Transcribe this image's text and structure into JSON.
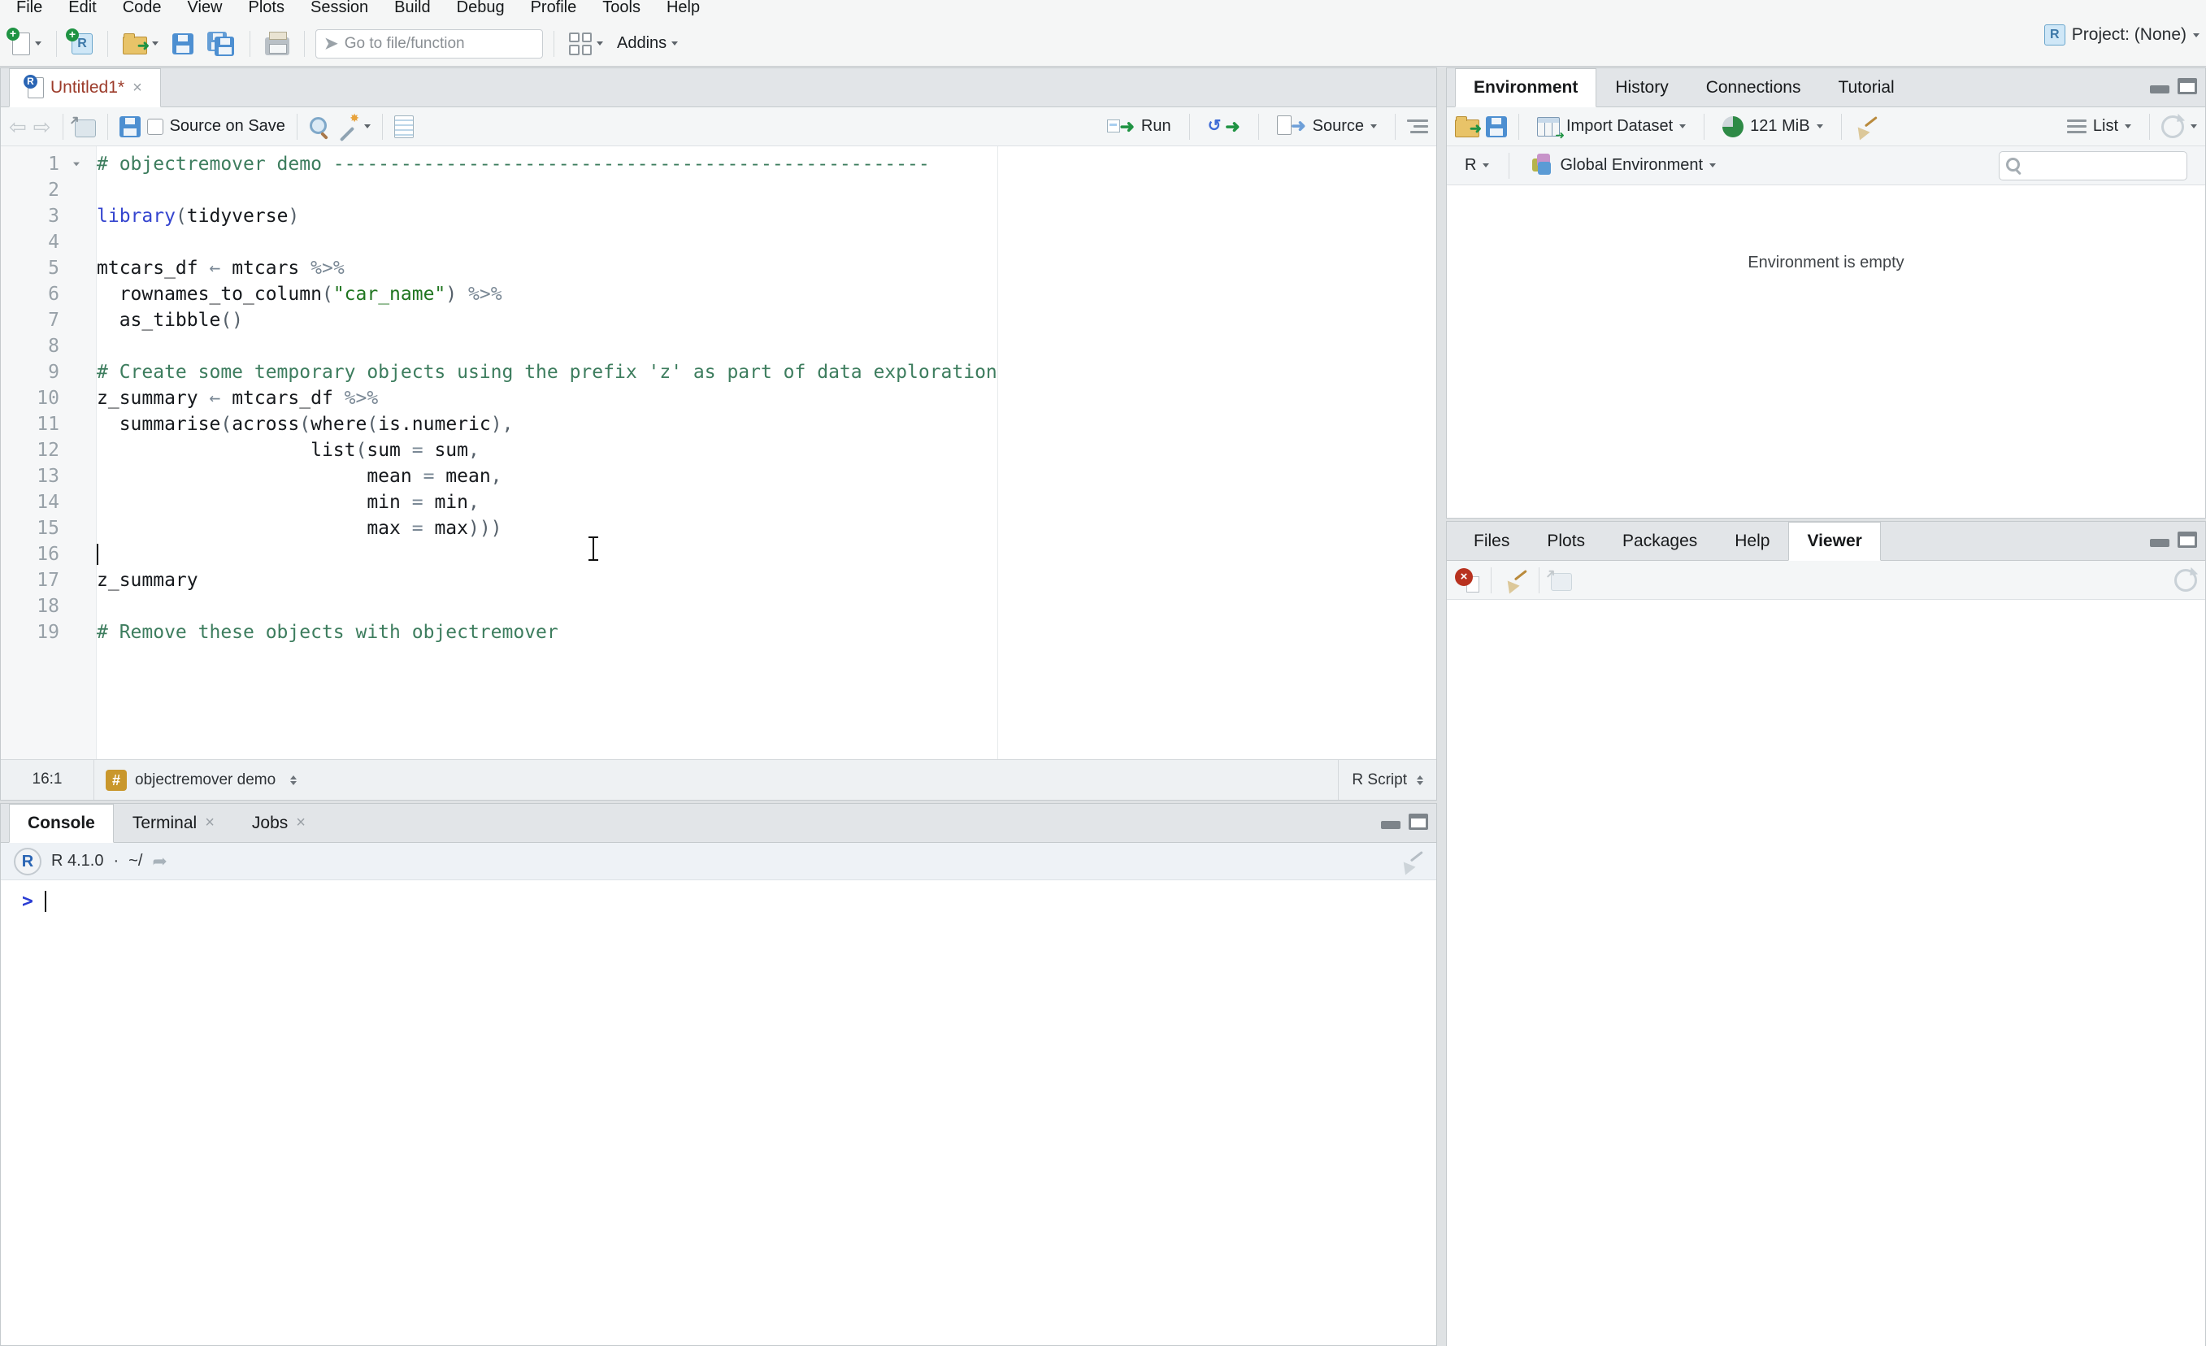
{
  "colors": {
    "comment": "#3d7d5e",
    "string": "#207520",
    "keyword": "#3545cf",
    "operator": "#7a8895",
    "punct": "#55606a",
    "codetext": "#16191d",
    "linenum": "#98a1a8",
    "prompt": "#2a3cd3",
    "tabmod": "#9c3b2a"
  },
  "menu": {
    "items": [
      "File",
      "Edit",
      "Code",
      "View",
      "Plots",
      "Session",
      "Build",
      "Debug",
      "Profile",
      "Tools",
      "Help"
    ]
  },
  "toolbar": {
    "goto_placeholder": "Go to file/function",
    "addins_label": "Addins",
    "project_label": "Project: (None)"
  },
  "editor": {
    "tab_title": "Untitled1*",
    "toolbar": {
      "source_on_save": "Source on Save",
      "run_label": "Run",
      "source_label": "Source"
    },
    "status": {
      "cursor_position": "16:1",
      "section_label": "objectremover demo",
      "file_type": "R Script",
      "hash": "#"
    },
    "code": {
      "lines": [
        {
          "n": 1,
          "fold": true,
          "segs": [
            [
              "comment",
              "# objectremover demo -----------------------------------------------------"
            ]
          ]
        },
        {
          "n": 2,
          "segs": []
        },
        {
          "n": 3,
          "segs": [
            [
              "keyword",
              "library"
            ],
            [
              "punc",
              "("
            ],
            [
              "text",
              "tidyverse"
            ],
            [
              "punc",
              ")"
            ]
          ]
        },
        {
          "n": 4,
          "segs": []
        },
        {
          "n": 5,
          "segs": [
            [
              "text",
              "mtcars_df "
            ],
            [
              "op",
              "← "
            ],
            [
              "text",
              "mtcars "
            ],
            [
              "op",
              "%>%"
            ]
          ]
        },
        {
          "n": 6,
          "segs": [
            [
              "text",
              "  rownames_to_column"
            ],
            [
              "punc",
              "("
            ],
            [
              "string",
              "\"car_name\""
            ],
            [
              "punc",
              ")"
            ],
            [
              "text",
              " "
            ],
            [
              "op",
              "%>%"
            ]
          ]
        },
        {
          "n": 7,
          "segs": [
            [
              "text",
              "  as_tibble"
            ],
            [
              "punc",
              "()"
            ]
          ]
        },
        {
          "n": 8,
          "segs": []
        },
        {
          "n": 9,
          "segs": [
            [
              "comment",
              "# Create some temporary objects using the prefix 'z' as part of data exploration"
            ]
          ]
        },
        {
          "n": 10,
          "segs": [
            [
              "text",
              "z_summary "
            ],
            [
              "op",
              "← "
            ],
            [
              "text",
              "mtcars_df "
            ],
            [
              "op",
              "%>%"
            ]
          ]
        },
        {
          "n": 11,
          "segs": [
            [
              "text",
              "  summarise"
            ],
            [
              "punc",
              "("
            ],
            [
              "text",
              "across"
            ],
            [
              "punc",
              "("
            ],
            [
              "text",
              "where"
            ],
            [
              "punc",
              "("
            ],
            [
              "text",
              "is.numeric"
            ],
            [
              "punc",
              "),"
            ]
          ]
        },
        {
          "n": 12,
          "segs": [
            [
              "text",
              "                   list"
            ],
            [
              "punc",
              "("
            ],
            [
              "text",
              "sum "
            ],
            [
              "op",
              "= "
            ],
            [
              "text",
              "sum"
            ],
            [
              "punc",
              ","
            ]
          ]
        },
        {
          "n": 13,
          "segs": [
            [
              "text",
              "                        mean "
            ],
            [
              "op",
              "= "
            ],
            [
              "text",
              "mean"
            ],
            [
              "punc",
              ","
            ]
          ]
        },
        {
          "n": 14,
          "segs": [
            [
              "text",
              "                        min "
            ],
            [
              "op",
              "= "
            ],
            [
              "text",
              "min"
            ],
            [
              "punc",
              ","
            ]
          ]
        },
        {
          "n": 15,
          "segs": [
            [
              "text",
              "                        max "
            ],
            [
              "op",
              "= "
            ],
            [
              "text",
              "max"
            ],
            [
              "punc",
              ")))"
            ]
          ]
        },
        {
          "n": 16,
          "caret": true,
          "segs": []
        },
        {
          "n": 17,
          "segs": [
            [
              "text",
              "z_summary"
            ]
          ]
        },
        {
          "n": 18,
          "segs": []
        },
        {
          "n": 19,
          "segs": [
            [
              "comment",
              "# Remove these objects with objectremover"
            ]
          ]
        }
      ]
    }
  },
  "console": {
    "tabs": [
      {
        "label": "Console",
        "active": true
      },
      {
        "label": "Terminal",
        "closable": true
      },
      {
        "label": "Jobs",
        "closable": true
      }
    ],
    "version": "R 4.1.0",
    "separator": "·",
    "working_dir": "~/",
    "prompt": ">"
  },
  "environment": {
    "tabs": [
      {
        "label": "Environment",
        "active": true
      },
      {
        "label": "History"
      },
      {
        "label": "Connections"
      },
      {
        "label": "Tutorial"
      }
    ],
    "toolbar": {
      "import_label": "Import Dataset",
      "memory_usage": "121 MiB",
      "list_label": "List"
    },
    "scope": {
      "language": "R",
      "environment": "Global Environment"
    },
    "empty_message": "Environment is empty"
  },
  "files": {
    "tabs": [
      {
        "label": "Files"
      },
      {
        "label": "Plots"
      },
      {
        "label": "Packages"
      },
      {
        "label": "Help"
      },
      {
        "label": "Viewer",
        "active": true
      }
    ]
  }
}
